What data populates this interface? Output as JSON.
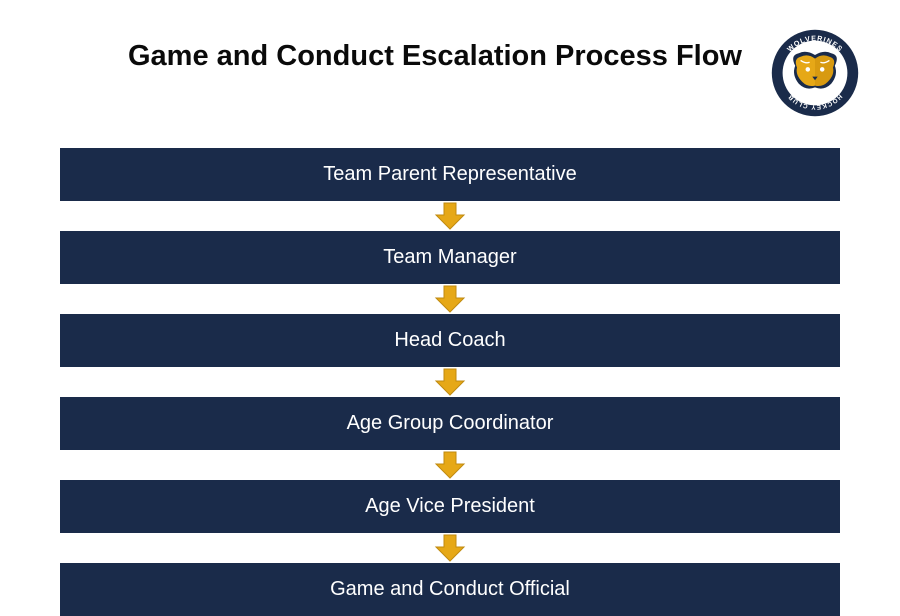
{
  "title": "Game and Conduct Escalation Process Flow",
  "logo": {
    "top_text": "WOLVERINES",
    "bottom_text": "HOCKEY CLUB",
    "ring_color": "#1a2b4a",
    "accent_color": "#e6a817",
    "text_color": "#ffffff"
  },
  "colors": {
    "step_bg": "#1a2b4a",
    "step_text": "#ffffff",
    "arrow_fill": "#e6a817",
    "arrow_stroke": "#c08a0f"
  },
  "steps": [
    {
      "label": "Team Parent Representative"
    },
    {
      "label": "Team Manager"
    },
    {
      "label": "Head Coach"
    },
    {
      "label": "Age Group Coordinator"
    },
    {
      "label": "Age Vice President"
    },
    {
      "label": "Game and Conduct Official"
    }
  ]
}
